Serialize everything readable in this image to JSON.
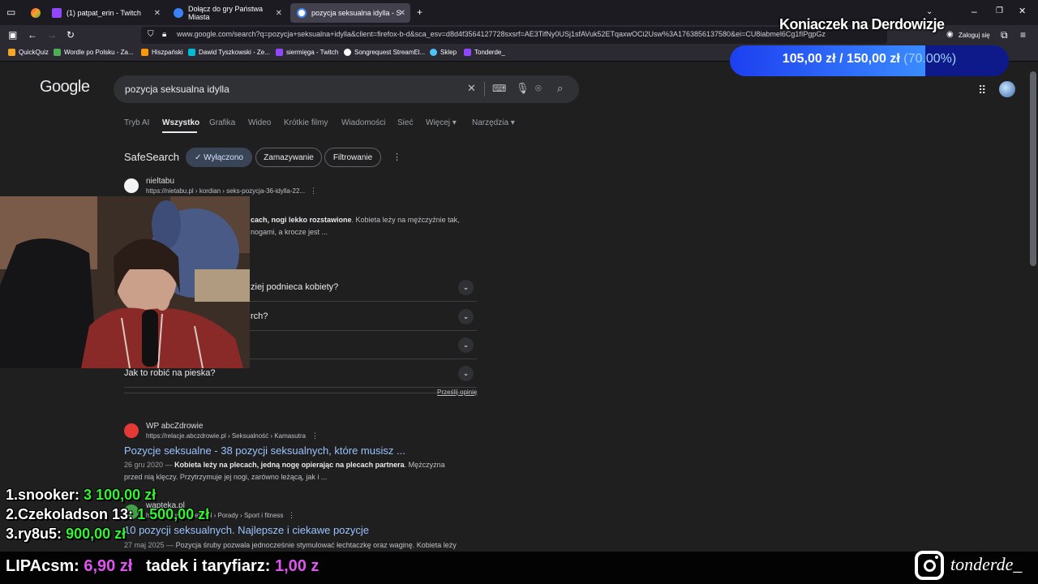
{
  "browser": {
    "tabs": [
      {
        "label": "",
        "color": "#9146ff"
      },
      {
        "label": "(1) patpat_erin - Twitch",
        "color": "#9146ff"
      },
      {
        "label": "Dołącz do gry Państwa Miasta",
        "color": "#3b82f6"
      },
      {
        "label": "pozycja seksualna idylla - Szuka",
        "color": "#4285f4"
      }
    ],
    "url": "www.google.com/search?q=pozycja+seksualna+idylla&client=firefox-b-d&sca_esv=d8d4f3564127728sxsrf=AE3TifNy0USj1sfAVuk52ETqaxwOCi2Usw%3A1763856137580&ei=CU8iabmel6Cg1fIPgpGz",
    "login_label": "Zaloguj się",
    "bookmarks": [
      {
        "label": "QuickQuiz",
        "color": "#f5a623"
      },
      {
        "label": "Wordle po Polsku - Za...",
        "color": "#4caf50"
      },
      {
        "label": "Hiszpański",
        "color": "#ff9800"
      },
      {
        "label": "Dawid Tyszkowski - Ze...",
        "color": "#00bcd4"
      },
      {
        "label": "siermięga - Twitch",
        "color": "#9146ff"
      },
      {
        "label": "Songrequest StreamEl...",
        "color": "#ffffff"
      },
      {
        "label": "Sklep",
        "color": "#4fc3f7"
      },
      {
        "label": "Tonderde_",
        "color": "#9146ff"
      }
    ]
  },
  "google": {
    "logo": "Google",
    "query": "pozycja seksualna idylla",
    "nav_tabs": [
      "Tryb AI",
      "Wszystko",
      "Grafika",
      "Wideo",
      "Krótkie filmy",
      "Wiadomości",
      "Sieć",
      "Więcej ▾",
      "Narzędzia ▾"
    ],
    "safesearch": {
      "label": "SafeSearch",
      "chips": [
        "✓ Wyłączono",
        "Zamazywanie",
        "Filtrowanie"
      ]
    },
    "result1": {
      "site": "nieltabu",
      "url": "https://nietabu.pl › kordian › seks-pozycja-36-idylla-22...",
      "snippet_bold": "cach, nogi lekko rozstawione",
      "snippet_rest": ". Kobieta leży na mężczyźnie tak,",
      "snippet_line2": "nogami, a krocze jest ..."
    },
    "faq": [
      "ziej podnieca kobiety?",
      "rch?",
      "",
      "Jak to robić na pieska?"
    ],
    "feedback": "Prześlij opinię",
    "result2": {
      "site": "WP abcZdrowie",
      "url": "https://relacje.abczdrowie.pl › Seksualność › Kamasutra",
      "title": "Pozycje seksualne - 38 pozycji seksualnych, które musisz ...",
      "date": "26 gru 2020 —",
      "snippet_bold": "Kobieta leży na plecach, jedną nogę opierając na plecach partnera",
      "snippet_rest": ". Mężczyzna",
      "snippet_line2": "przed nią klęczy. Przytrzymuje jej nogi, zarówno leżącą, jak i ..."
    },
    "result3": {
      "site": "wapteka.pl",
      "url": "https://www.wapteka.pl › Porady › Sport i fitness",
      "title": "10 pozycji seksualnych. Najlepsze i ciekawe pozycje",
      "date": "27 maj 2025 —",
      "snippet": "Pozycja śruby pozwala jednocześnie stymulować łechtaczkę oraz waginę. Kobieta leży"
    }
  },
  "stream": {
    "goal_title": "Koniaczek na Derdowizje",
    "goal_current": "105,00 zł",
    "goal_sep": "/",
    "goal_target": "150,00 zł",
    "goal_percent": "(70.00%)",
    "goal_fraction": 0.7,
    "leaderboard": [
      {
        "name": "1.snooker:",
        "amount": "3 100,00 zł"
      },
      {
        "name": "2.Czekoladson 13:",
        "amount": "1 500,00 zł"
      },
      {
        "name": "3.ry8u5:",
        "amount": "900,00 zł"
      }
    ],
    "ticker": [
      {
        "name": "LIPAcsm:",
        "amount": "6,90 zł"
      },
      {
        "name": "tadek i taryfiarz:",
        "amount": "1,00 z"
      }
    ],
    "instagram": "tonderde_"
  }
}
